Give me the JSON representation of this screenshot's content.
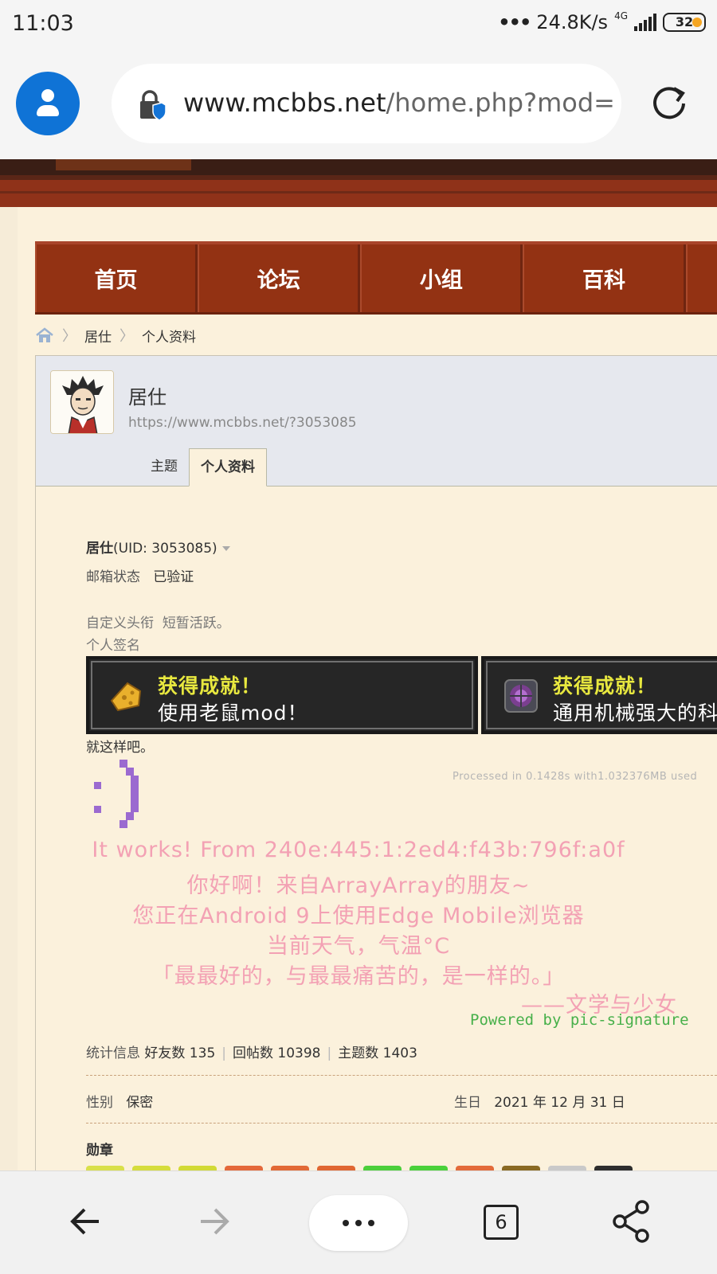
{
  "statusbar": {
    "time": "11:03",
    "speed": "24.8K/s",
    "network": "4G",
    "battery": "32"
  },
  "browser": {
    "url_domain": "www.mcbbs.net",
    "url_path": "/home.php?mod=",
    "tab_count": "6",
    "icons": [
      "account-icon",
      "lock-shield-icon",
      "reload-icon",
      "back-icon",
      "forward-icon",
      "more-icon",
      "tabs-icon",
      "share-icon"
    ]
  },
  "nav": {
    "items": [
      "首页",
      "论坛",
      "小组",
      "百科"
    ]
  },
  "breadcrumb": {
    "items": [
      "居仕",
      "个人资料"
    ]
  },
  "profile": {
    "name": "居仕",
    "url": "https://www.mcbbs.net/?3053085",
    "tabs": [
      "主题",
      "个人资料"
    ],
    "uid_name": "居仕",
    "uid_text": "(UID: 3053085)",
    "email_label": "邮箱状态",
    "email_value": "已验证",
    "custom_title_label": "自定义头衔",
    "custom_title_value": "短暂活跃。",
    "signature_label": "个人签名",
    "signature_text": "就这样吧。"
  },
  "achievements": [
    {
      "title": "获得成就！",
      "desc": "使用老鼠mod！"
    },
    {
      "title": "获得成就！",
      "desc": "通用机械强大的科技"
    }
  ],
  "signature_image": {
    "processed": "Processed in 0.1428s with1.032376MB used",
    "lines": [
      "It works! From 240e:445:1:2ed4:f43b:796f:a0f",
      "你好啊！来自ArrayArray的朋友~",
      "您正在Android 9上使用Edge Mobile浏览器",
      "当前天气，气温°C",
      "「最最好的，与最最痛苦的，是一样的。」",
      "——文学与少女"
    ],
    "powered": "Powered by pic-signature"
  },
  "stats": {
    "label": "统计信息",
    "friends": "好友数 135",
    "replies": "回帖数 10398",
    "threads": "主题数 1403"
  },
  "details": {
    "gender_label": "性别",
    "gender_value": "保密",
    "birthday_label": "生日",
    "birthday_value": "2021 年 12 月 31 日",
    "medals_label": "勋章"
  },
  "colors": {
    "nav_bg": "#933213",
    "page_bg": "#fbf1dc",
    "accent_blue": "#0f73d6",
    "sig_pink": "#f3a1b4",
    "sig_green": "#47b04a",
    "achievement_yellow": "#e8e83f"
  }
}
